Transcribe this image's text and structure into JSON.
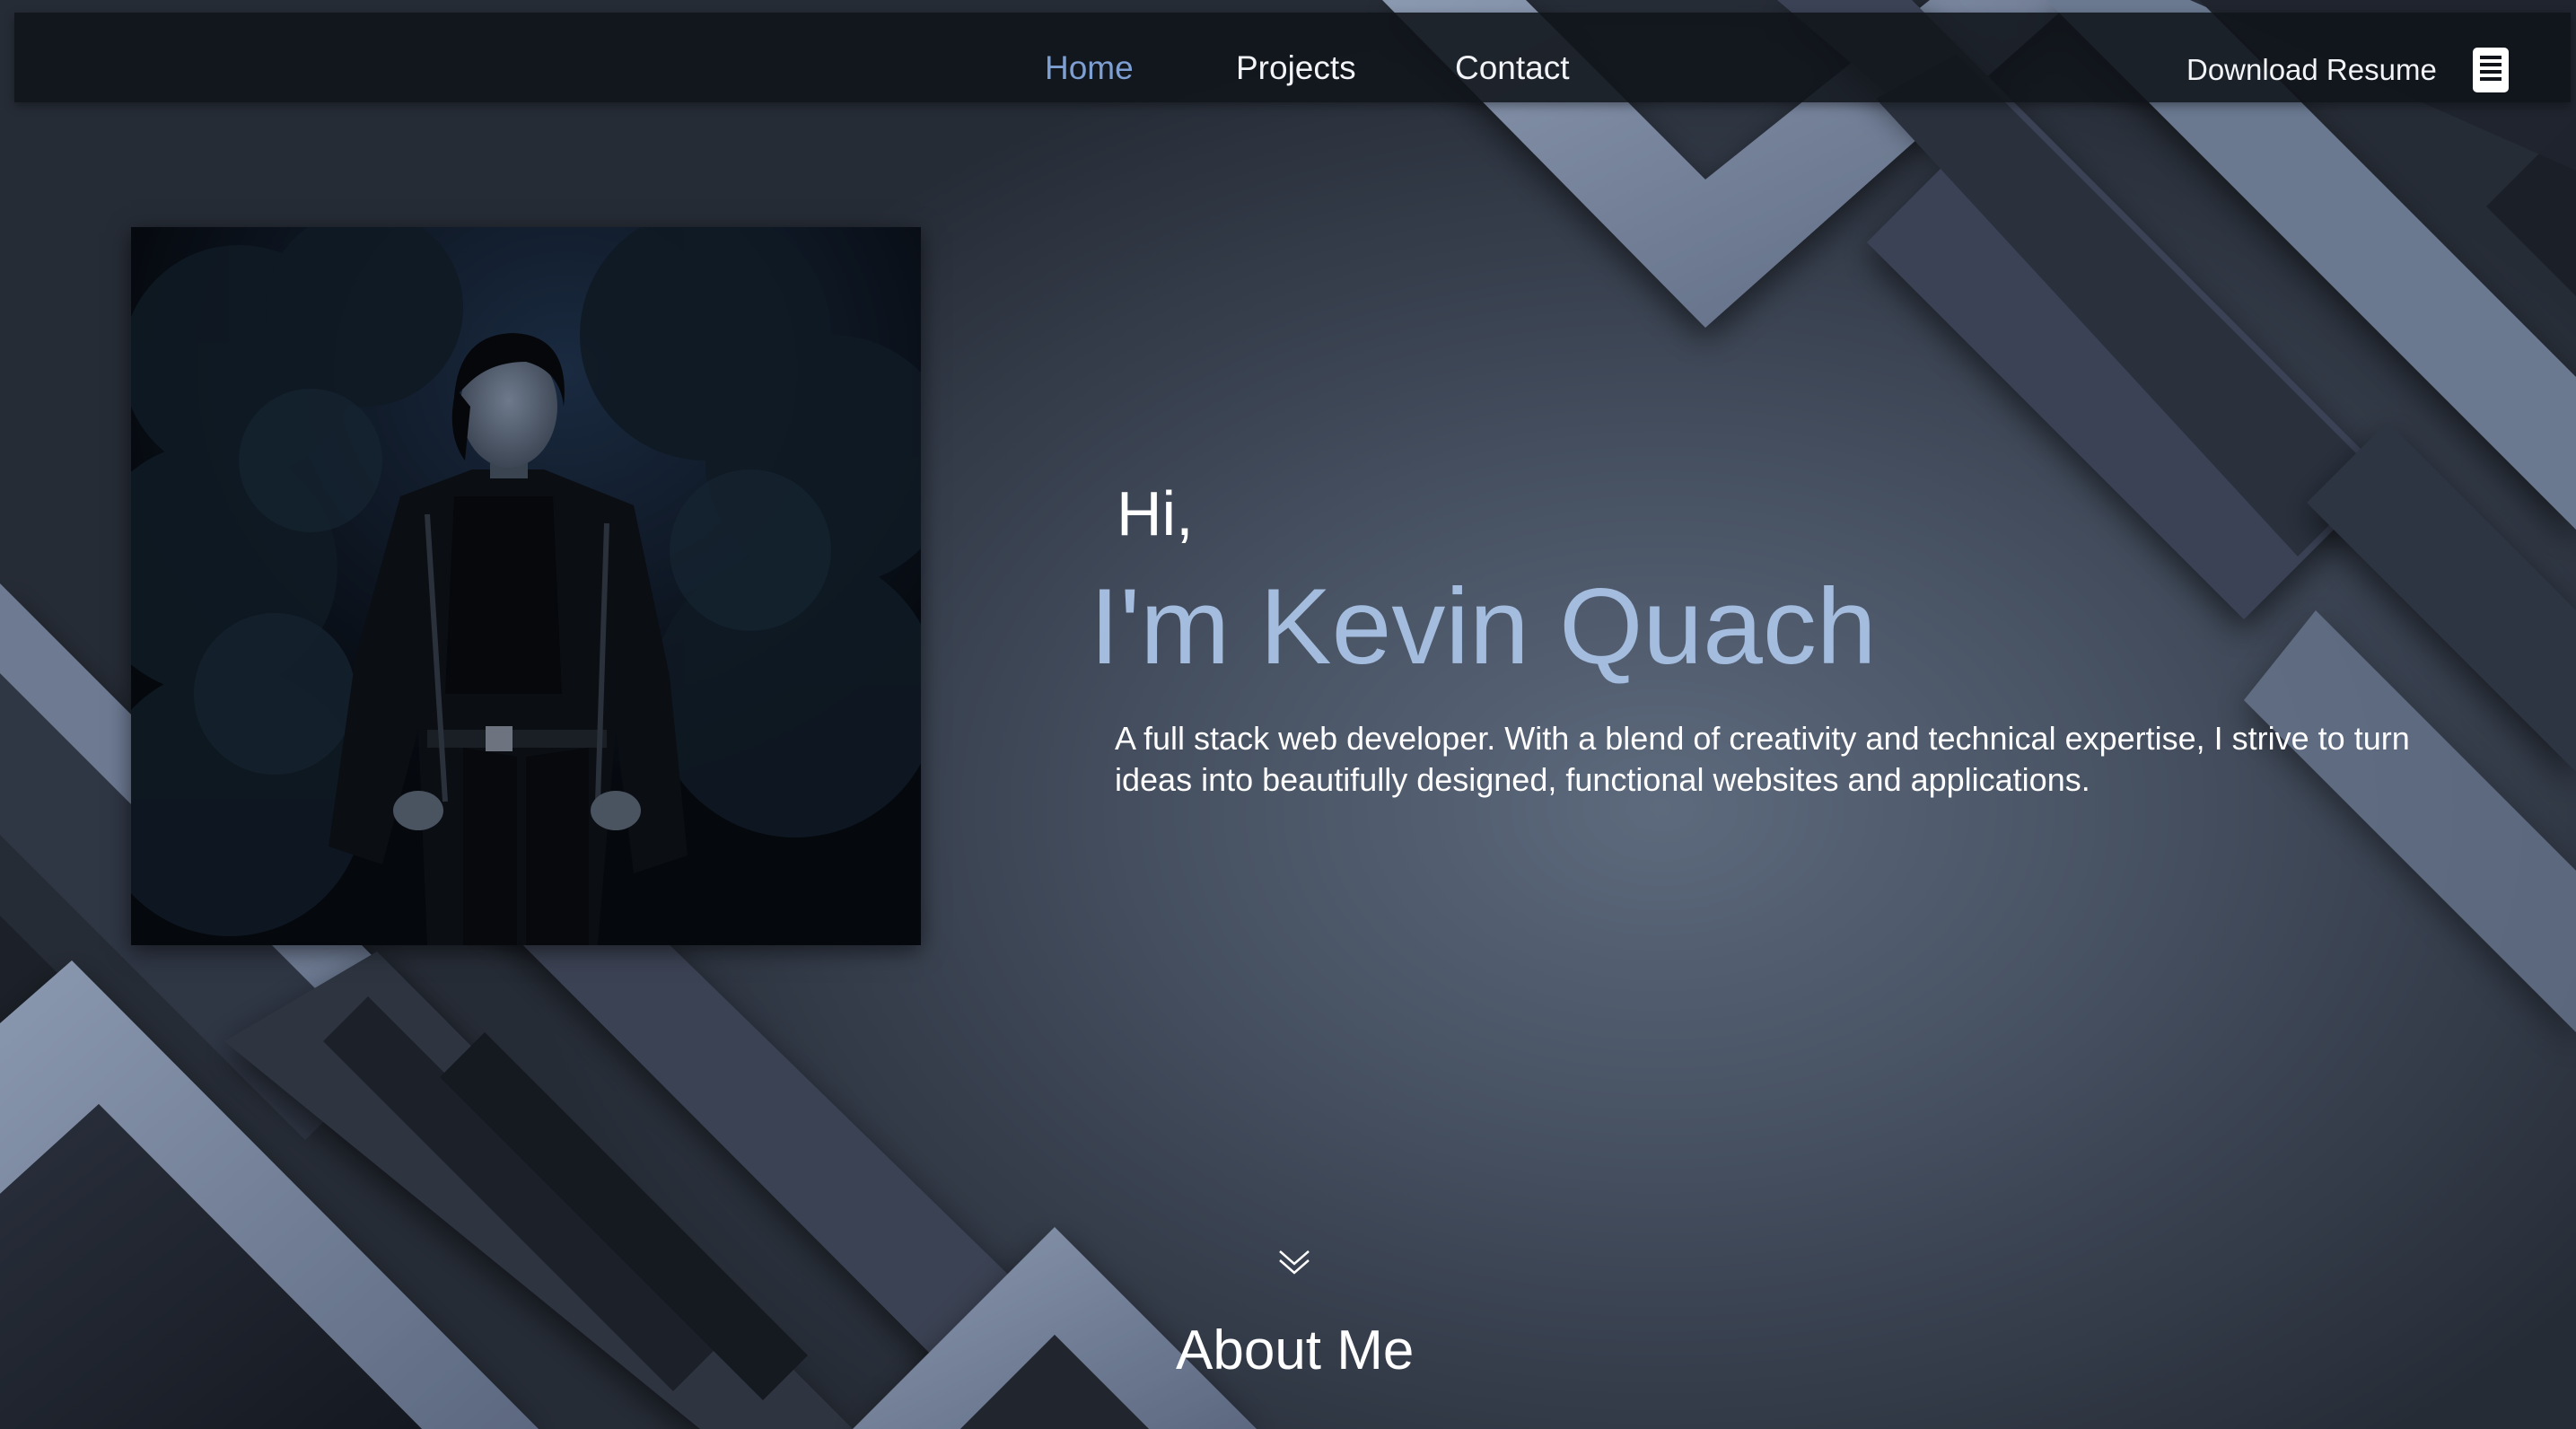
{
  "nav": {
    "links": [
      "Home",
      "Projects",
      "Contact"
    ],
    "active": "Home",
    "resume_label": "Download Resume"
  },
  "hero": {
    "greeting": "Hi,",
    "name": "I'm Kevin Quach",
    "description": "A full stack web developer. With a blend of creativity and technical expertise, I strive to turn ideas into beautifully designed, functional websites and applications."
  },
  "about": {
    "heading": "About Me"
  },
  "icons": {
    "resume": "document-icon",
    "scroll": "chevron-double-down-icon"
  },
  "colors": {
    "accent": "#a4bcdd",
    "active_link": "#7e9fd2",
    "navbar": "#10141a",
    "text": "#ffffff"
  }
}
